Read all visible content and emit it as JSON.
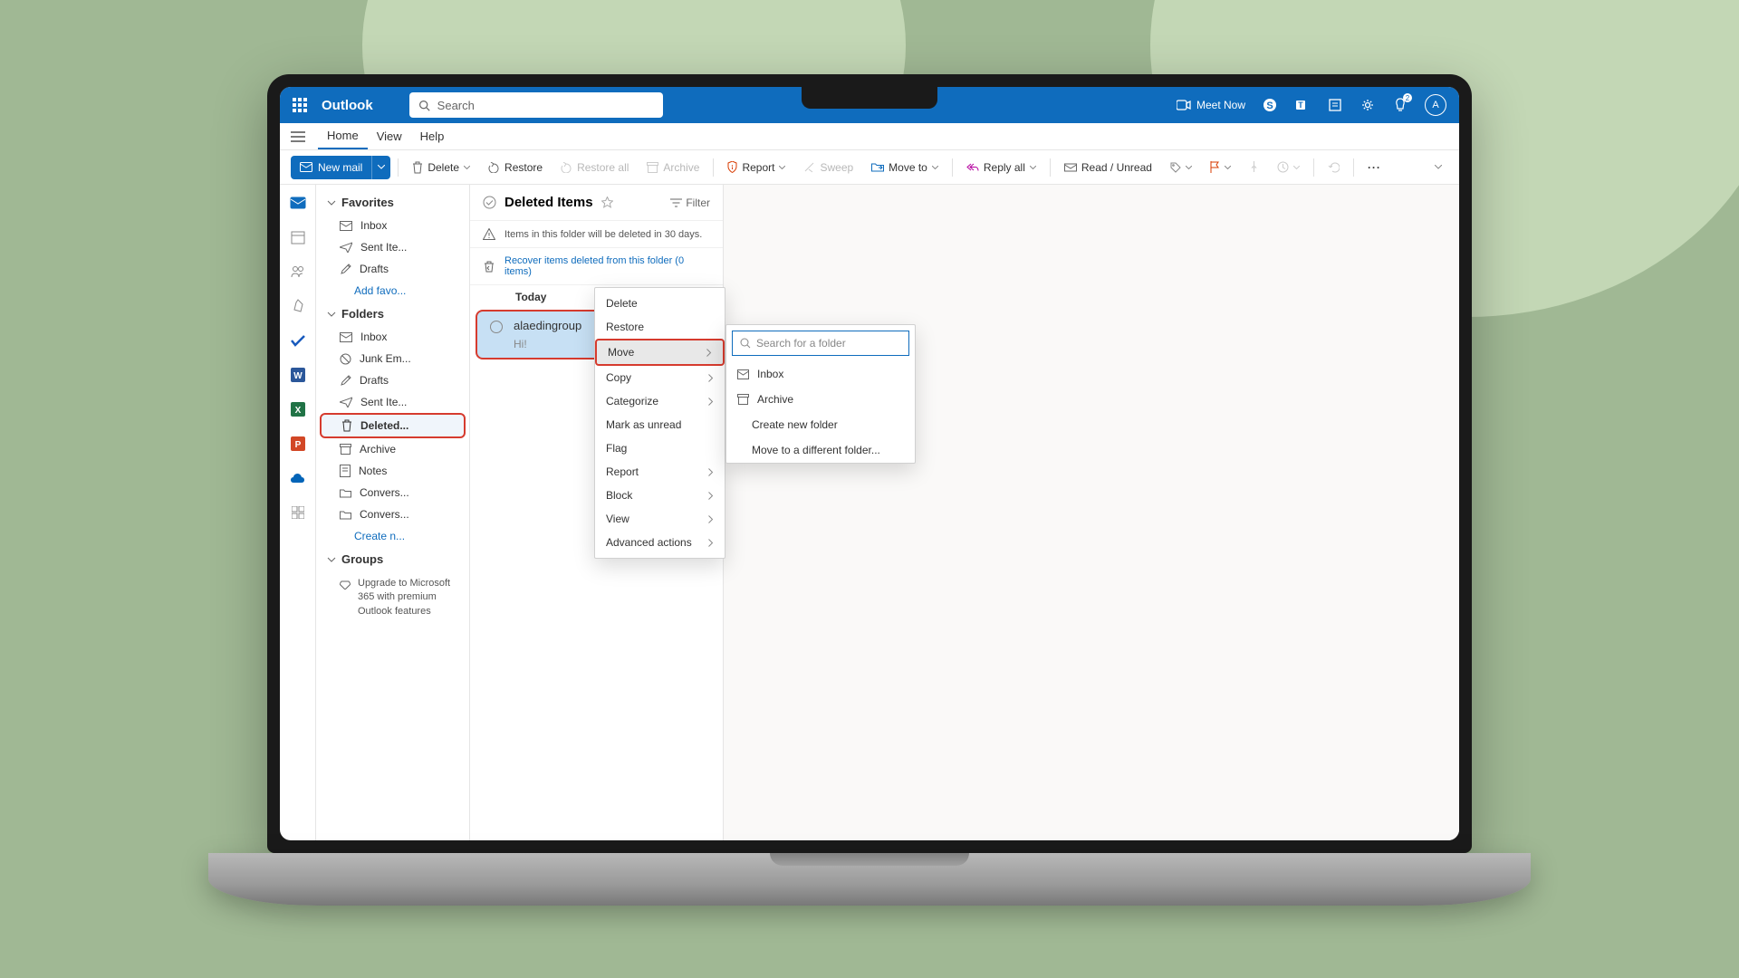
{
  "header": {
    "app_title": "Outlook",
    "search_placeholder": "Search",
    "meet_now": "Meet Now",
    "avatar_letter": "A",
    "notif_count": "2"
  },
  "tabs": {
    "home": "Home",
    "view": "View",
    "help": "Help"
  },
  "ribbon": {
    "new_mail": "New mail",
    "delete": "Delete",
    "restore": "Restore",
    "restore_all": "Restore all",
    "archive": "Archive",
    "report": "Report",
    "sweep": "Sweep",
    "move_to": "Move to",
    "reply_all": "Reply all",
    "read_unread": "Read / Unread"
  },
  "sidebar": {
    "favorites": "Favorites",
    "fav_items": [
      "Inbox",
      "Sent Ite...",
      "Drafts"
    ],
    "add_favorite": "Add favo...",
    "folders": "Folders",
    "folder_items": [
      "Inbox",
      "Junk Em...",
      "Drafts",
      "Sent Ite...",
      "Deleted...",
      "Archive",
      "Notes",
      "Convers...",
      "Convers..."
    ],
    "create_new": "Create n...",
    "groups": "Groups",
    "upgrade": "Upgrade to Microsoft 365 with premium Outlook features"
  },
  "msglist": {
    "folder_title": "Deleted Items",
    "filter": "Filter",
    "retention": "Items in this folder will be deleted in 30 days.",
    "recover": "Recover items deleted from this folder (0 items)",
    "date_group": "Today",
    "sender": "alaedingroup",
    "preview": "Hi!"
  },
  "context_menu": {
    "items": [
      "Delete",
      "Restore",
      "Move",
      "Copy",
      "Categorize",
      "Mark as unread",
      "Flag",
      "Report",
      "Block",
      "View",
      "Advanced actions"
    ]
  },
  "submenu": {
    "search_placeholder": "Search for a folder",
    "inbox": "Inbox",
    "archive": "Archive",
    "create": "Create new folder",
    "move_diff": "Move to a different folder..."
  }
}
